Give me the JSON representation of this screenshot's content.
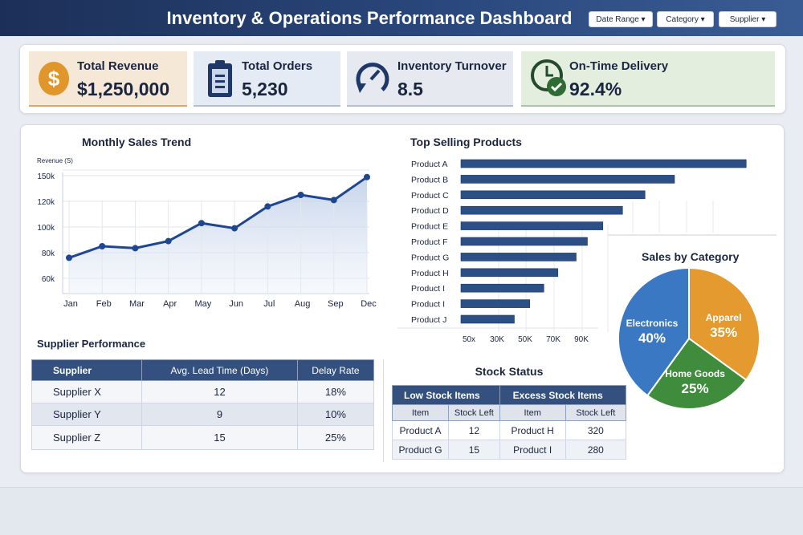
{
  "header": {
    "title": "Inventory & Operations Performance Dashboard",
    "filters": [
      "Date Range",
      "Category",
      "Supplier"
    ]
  },
  "kpis": [
    {
      "label": "Total Revenue",
      "value": "$1,250,000",
      "icon": "dollar-icon",
      "bg": "#f6e8d6"
    },
    {
      "label": "Total Orders",
      "value": "5,230",
      "icon": "clipboard-icon",
      "bg": "#e4ebf4"
    },
    {
      "label": "Inventory Turnover",
      "value": "8.5",
      "icon": "turnover-cycle-icon",
      "bg": "#e6e9ef"
    },
    {
      "label": "On-Time Delivery",
      "value": "92.4%",
      "icon": "clock-check-icon",
      "bg": "#e3eedf"
    }
  ],
  "chart_data": [
    {
      "type": "area",
      "title": "Monthly Sales Trend",
      "ylabel": "Revenue (S)",
      "categories": [
        "Jan",
        "Feb",
        "Mar",
        "Apr",
        "May",
        "Jun",
        "Jul",
        "Aug",
        "Sep",
        "Dec"
      ],
      "values": [
        76,
        85,
        83.5,
        89,
        103,
        99,
        116,
        125,
        121,
        148
      ],
      "yticks": [
        "60k",
        "80k",
        "100k",
        "120k",
        "150k"
      ],
      "ylim": [
        50,
        160
      ],
      "grid": true,
      "color": "#1f4690"
    },
    {
      "type": "bar",
      "orientation": "horizontal",
      "title": "Top Selling Products",
      "categories": [
        "Product A",
        "Product B",
        "Product C",
        "Product D",
        "Product E",
        "Product F",
        "Product G",
        "Product H",
        "Product I",
        "Product I",
        "Product J"
      ],
      "values": [
        203,
        152,
        131,
        115,
        101,
        90,
        82,
        69,
        59,
        49,
        38
      ],
      "xticks": [
        "50x",
        "30K",
        "50K",
        "70K",
        "90K"
      ],
      "color": "#2c4f86"
    },
    {
      "type": "pie",
      "title": "Sales by Category",
      "slices": [
        {
          "label": "Apparel",
          "value": 35,
          "pct": "35%",
          "color": "#e49a2e"
        },
        {
          "label": "Home Goods",
          "value": 25,
          "pct": "25%",
          "color": "#3f8c3c"
        },
        {
          "label": "Electronics",
          "value": 40,
          "pct": "40%",
          "color": "#3a78c4"
        }
      ]
    }
  ],
  "supplier": {
    "title": "Supplier Performance",
    "headers": [
      "Supplier",
      "Avg. Lead Time (Days)",
      "Delay Rate"
    ],
    "rows": [
      [
        "Supplier X",
        "12",
        "18%"
      ],
      [
        "Supplier Y",
        "9",
        "10%"
      ],
      [
        "Supplier Z",
        "15",
        "25%"
      ]
    ]
  },
  "stock": {
    "title": "Stock Status",
    "groups": [
      "Low Stock Items",
      "Excess Stock Items"
    ],
    "subheaders": [
      "Item",
      "Stock Left",
      "Item",
      "Stock Left"
    ],
    "rows": [
      [
        "Product A",
        "12",
        "Product H",
        "320"
      ],
      [
        "Product G",
        "15",
        "Product I",
        "280"
      ]
    ]
  }
}
